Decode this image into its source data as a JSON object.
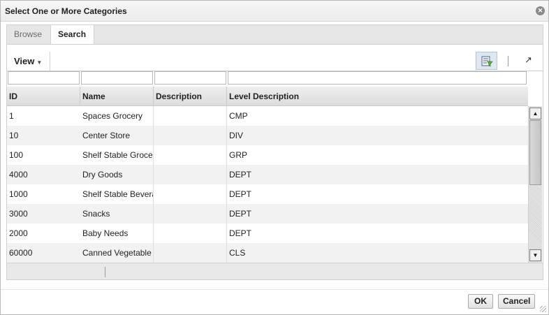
{
  "dialog": {
    "title": "Select One or More Categories",
    "close_icon": "close-icon"
  },
  "tabs": [
    {
      "label": "Browse",
      "selected": false
    },
    {
      "label": "Search",
      "selected": true
    }
  ],
  "toolbar": {
    "view_label": "View",
    "query_icon": "query-by-example-icon",
    "detach_icon": "detach-icon",
    "detach_glyph": "↗"
  },
  "filters": [
    {
      "column": "ID",
      "value": ""
    },
    {
      "column": "Name",
      "value": ""
    },
    {
      "column": "Description",
      "value": ""
    },
    {
      "column": "Level Description",
      "value": ""
    }
  ],
  "table": {
    "columns": [
      "ID",
      "Name",
      "Description",
      "Level Description"
    ],
    "rows": [
      [
        "1",
        "Spaces Grocery",
        "",
        "CMP"
      ],
      [
        "10",
        "Center Store",
        "",
        "DIV"
      ],
      [
        "100",
        "Shelf Stable Groce",
        "",
        "GRP"
      ],
      [
        "4000",
        "Dry Goods",
        "",
        "DEPT"
      ],
      [
        "1000",
        "Shelf Stable Bevera",
        "",
        "DEPT"
      ],
      [
        "3000",
        "Snacks",
        "",
        "DEPT"
      ],
      [
        "2000",
        "Baby Needs",
        "",
        "DEPT"
      ],
      [
        "60000",
        "Canned Vegetable",
        "",
        "CLS"
      ]
    ]
  },
  "buttons": {
    "ok_label": "OK",
    "cancel_label": "Cancel"
  },
  "colors": {
    "row_alt": "#f2f2f2",
    "header": "#dcdcdc",
    "selected_toolbar_button": "#dfe7ef"
  }
}
